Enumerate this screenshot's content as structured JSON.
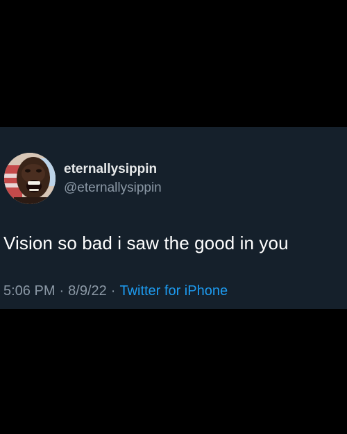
{
  "tweet": {
    "display_name": "eternallysippin",
    "handle": "@eternallysippin",
    "text": "Vision so bad i saw the good in you",
    "time": "5:06 PM",
    "date": "8/9/22",
    "separator": "·",
    "source": "Twitter for iPhone"
  },
  "avatar": {
    "icon": "profile-photo"
  },
  "colors": {
    "page_background": "#000000",
    "card_background": "#15202b",
    "primary_text": "#e7e9ea",
    "secondary_text": "#8b98a5",
    "link": "#1d9bf0"
  }
}
